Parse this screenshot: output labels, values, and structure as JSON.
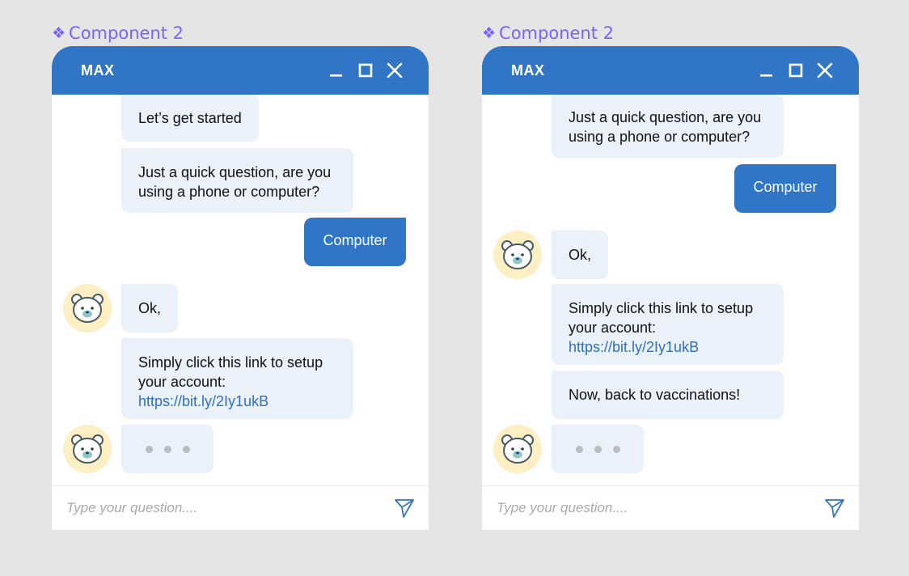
{
  "components": [
    {
      "label": "Component 2",
      "header_title": "MAX",
      "messages": {
        "m1": "Let’s get started",
        "m2": "Just a quick question, are you using a phone or computer?",
        "reply": "Computer",
        "m3": "Ok,",
        "m4_text": "Simply click this link to setup your account:",
        "m4_link": "https://bit.ly/2Iy1ukB"
      },
      "input_placeholder": "Type your question...."
    },
    {
      "label": "Component 2",
      "header_title": "MAX",
      "messages": {
        "m2": "Just a quick question, are you using a phone or computer?",
        "reply": "Computer",
        "m3": "Ok,",
        "m4_text": "Simply click this link to setup your account:",
        "m4_link": "https://bit.ly/2Iy1ukB",
        "m5": "Now, back to vaccinations!"
      },
      "input_placeholder": "Type your question...."
    }
  ],
  "colors": {
    "header": "#3176c6",
    "bot_bubble": "#eaf1f9",
    "user_bubble": "#3176c6",
    "avatar_bg": "#fcefc4",
    "component_label": "#7b61ff",
    "link": "#2f6fbd"
  },
  "icons": {
    "component": "four-diamond-component-icon",
    "minimize": "minimize-icon",
    "maximize": "maximize-icon",
    "close": "close-icon",
    "avatar": "polar-bear-avatar-icon",
    "send": "send-paper-plane-icon"
  }
}
